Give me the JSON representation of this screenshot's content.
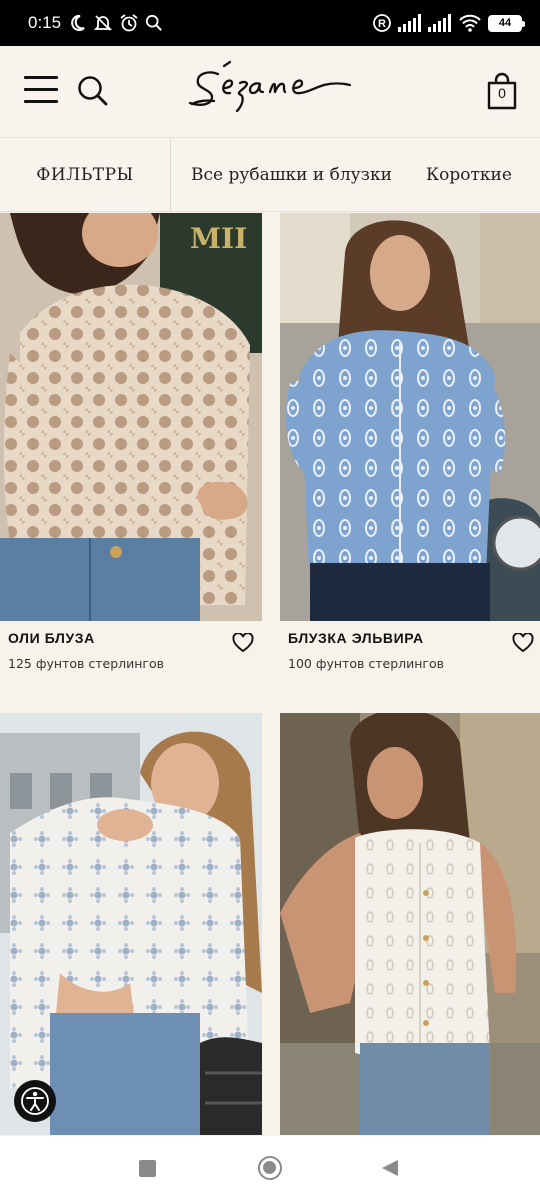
{
  "status_bar": {
    "time": "0:15",
    "battery": "44",
    "icons": [
      "moon-icon",
      "bell-off-icon",
      "alarm-icon",
      "search-icon",
      "registered-icon",
      "signal-icon",
      "signal-icon",
      "wifi-icon",
      "battery-icon"
    ]
  },
  "header": {
    "logo_text": "Sézane",
    "bag_count": "0",
    "icons": [
      "menu-icon",
      "search-icon",
      "bag-icon"
    ]
  },
  "filters": {
    "filter_label": "ФИЛЬТРЫ",
    "chips": [
      "Все рубашки и блузки",
      "Короткие"
    ]
  },
  "products": [
    {
      "name": "ОЛИ БЛУЗА",
      "price": "125 фунтов стерлингов"
    },
    {
      "name": "БЛУЗКА ЭЛЬВИРА",
      "price": "100 фунтов стерлингов"
    },
    {
      "name": "",
      "price": ""
    },
    {
      "name": "",
      "price": ""
    }
  ],
  "colors": {
    "page_bg": "#f7f2ea",
    "text": "#111111",
    "status_bar_bg": "#000000"
  }
}
